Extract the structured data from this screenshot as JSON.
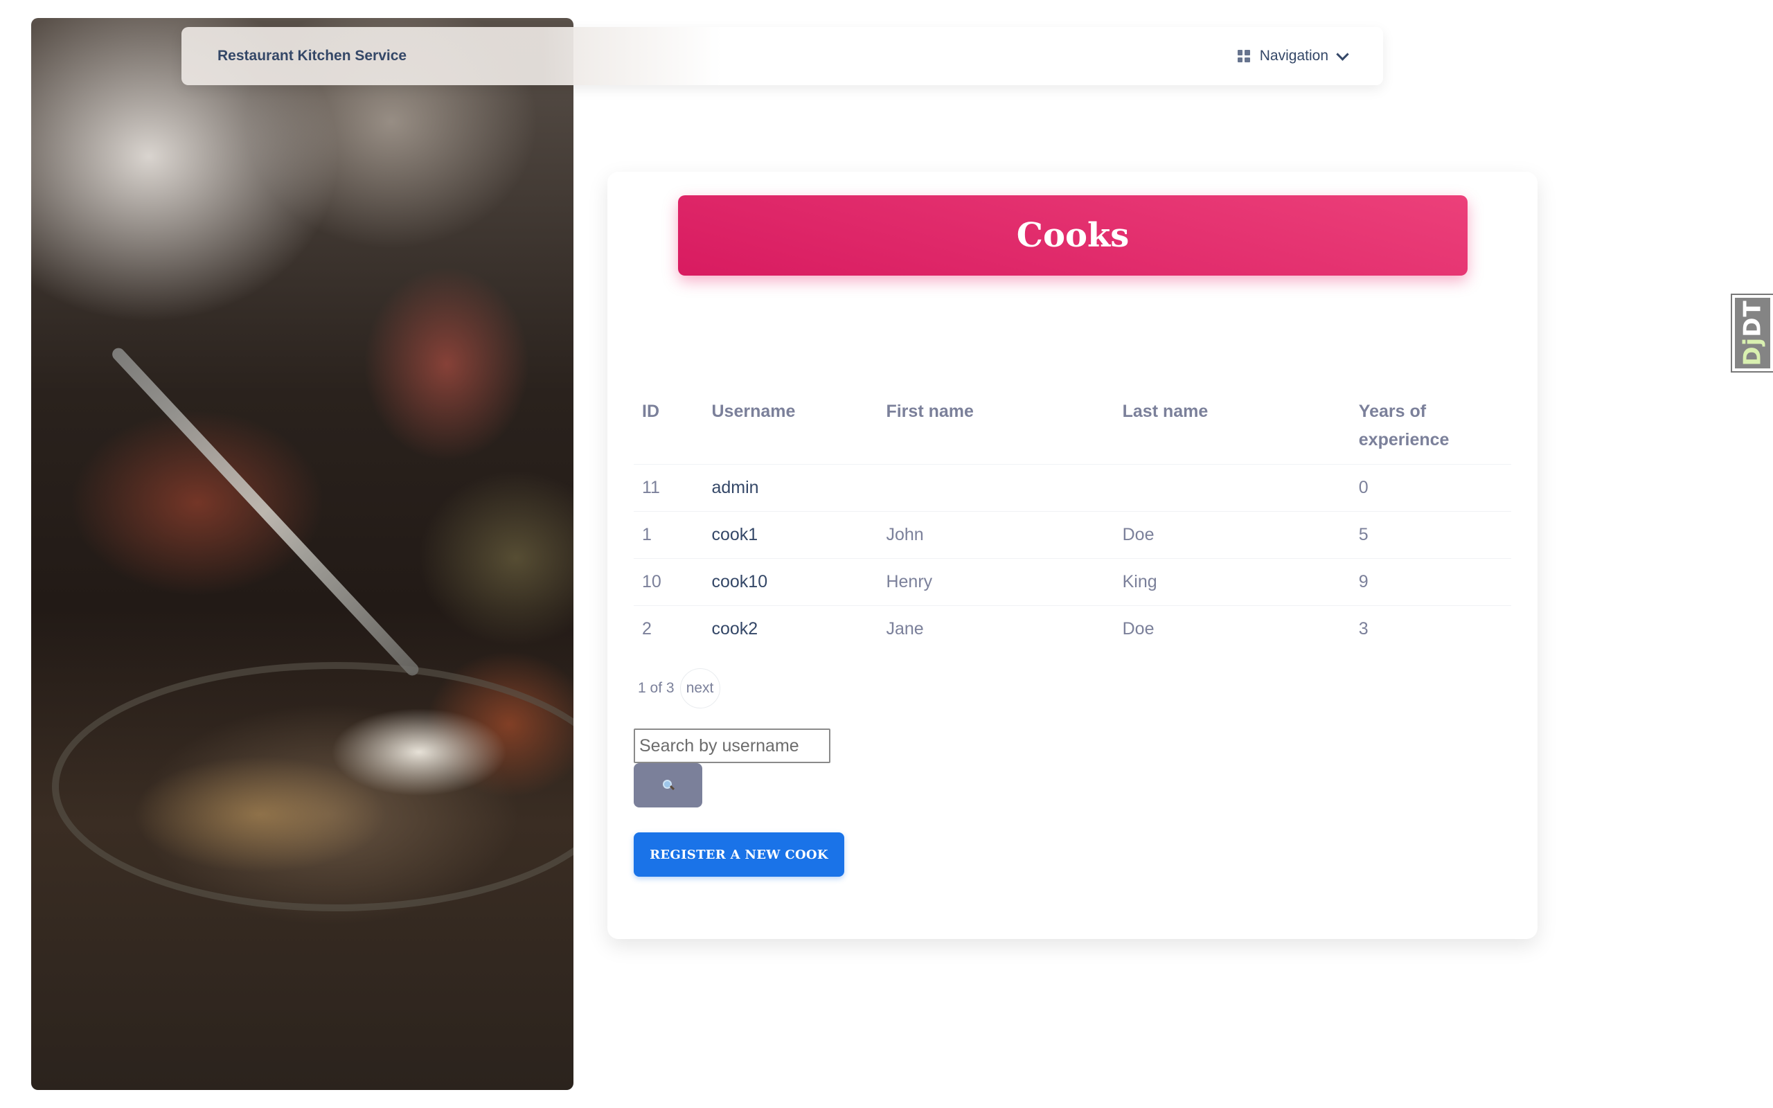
{
  "navbar": {
    "brand": "Restaurant Kitchen Service",
    "nav_label": "Navigation",
    "nav_icon": "dashboard-grid-icon"
  },
  "card": {
    "title": "Cooks",
    "header_gradient": [
      "#ec407a",
      "#d81b60"
    ]
  },
  "table": {
    "columns": [
      "ID",
      "Username",
      "First name",
      "Last name",
      "Years of experience"
    ],
    "rows": [
      {
        "id": "11",
        "username": "admin",
        "first_name": "",
        "last_name": "",
        "years": "0"
      },
      {
        "id": "1",
        "username": "cook1",
        "first_name": "John",
        "last_name": "Doe",
        "years": "5"
      },
      {
        "id": "10",
        "username": "cook10",
        "first_name": "Henry",
        "last_name": "King",
        "years": "9"
      },
      {
        "id": "2",
        "username": "cook2",
        "first_name": "Jane",
        "last_name": "Doe",
        "years": "3"
      }
    ]
  },
  "pagination": {
    "status": "1 of 3",
    "next_label": "next"
  },
  "search": {
    "placeholder": "Search by username",
    "value": "",
    "button_icon": "magnifying-glass-icon"
  },
  "register_button": "REGISTER A NEW COOK",
  "debug_toolbar": {
    "dj": "Dj",
    "dt": "DT"
  },
  "colors": {
    "primary": "#1a73e8",
    "secondary": "#7b809a",
    "accent": "#e91e63",
    "text_dark": "#344767"
  }
}
